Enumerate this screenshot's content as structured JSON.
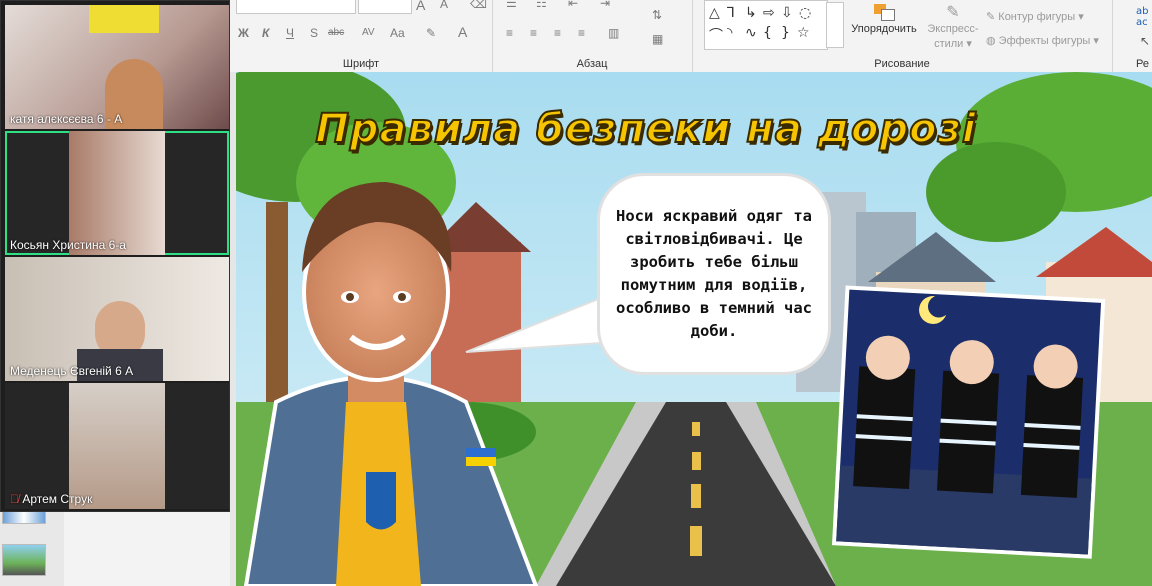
{
  "ribbon": {
    "font_group": "Шрифт",
    "paragraph_group": "Абзац",
    "drawing_group": "Рисование",
    "editing_group_partial": "Ре",
    "arrange_label": "Упорядочить",
    "quick_styles_label": "Экспресс-\nстили",
    "shape_outline_label": "Контур фигуры",
    "shape_effects_label": "Эффекты фигуры",
    "bold": "Ж",
    "italic": "К",
    "underline": "Ч",
    "strike": "S",
    "abc": "abc",
    "spacing": "AV",
    "font_color": "A",
    "case": "Aa"
  },
  "participants": [
    {
      "name": "катя алєксєєва 6 - А",
      "muted": false,
      "active": false
    },
    {
      "name": "Косьян Христина 6-а",
      "muted": false,
      "active": true
    },
    {
      "name": "Меденець Євгеній 6 А",
      "muted": false,
      "active": false
    },
    {
      "name": "Артем Струк",
      "muted": true,
      "active": false
    }
  ],
  "slide": {
    "title": "Правила безпеки на дорозі",
    "bubble_text": "Носи яскравий одяг та світловідбивачі. Це зробить тебе більш помутним для водіїв, особливо в темний час доби."
  },
  "colors": {
    "active_outline": "#2ee083",
    "title_fill": "#f7c400",
    "mute_red": "#e0403a"
  },
  "icons": [
    "align-left-icon",
    "align-center-icon",
    "align-right-icon",
    "justify-icon",
    "arrange-icon",
    "quick-styles-icon",
    "shape-outline-icon",
    "shape-effects-icon",
    "mic-muted-icon"
  ]
}
